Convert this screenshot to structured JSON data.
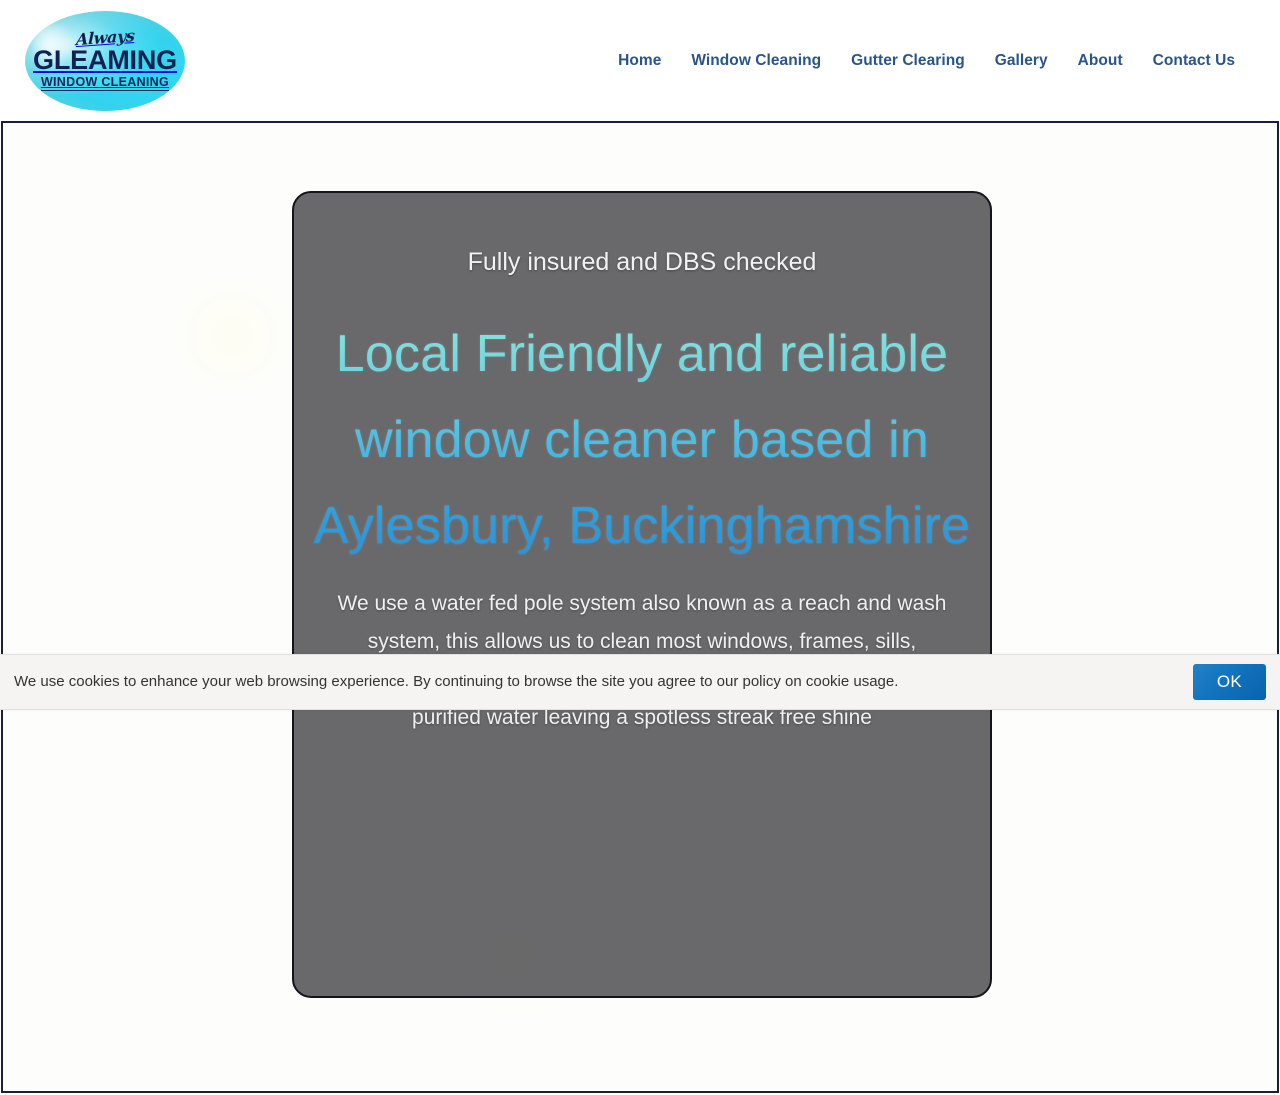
{
  "header": {
    "logo": {
      "script_word": "Always",
      "main_word": "GLEAMING",
      "sub_word": "WINDOW CLEANING"
    },
    "nav": [
      {
        "label": "Home"
      },
      {
        "label": "Window Cleaning"
      },
      {
        "label": "Gutter Clearing"
      },
      {
        "label": "Gallery"
      },
      {
        "label": "About"
      },
      {
        "label": "Contact Us"
      }
    ]
  },
  "hero": {
    "eyebrow": "Fully insured and DBS checked",
    "title": "Local Friendly and reliable window cleaner based in Aylesbury, Buckinghamshire",
    "body": "We use a water fed pole system also known as a reach and wash system, this allows us to clean most windows, frames, sills, fascia's and gutters from the safety of the ground using ultra purified water leaving a spotless streak free shine"
  },
  "cookie_banner": {
    "message": "We use cookies to enhance your web browsing experience. By continuing to browse the site you agree to our policy on cookie usage.",
    "accept_label": "OK"
  },
  "colors": {
    "nav_link": "#2a5588",
    "logo_oval": "#33d3ee",
    "logo_text": "#132152",
    "hero_card_bg": "#545456",
    "hero_title_top": "#8fe9e0",
    "hero_title_bottom": "#2b8fd6",
    "cookie_bg": "#f5f4f2",
    "ok_button": "#1374bf",
    "frame_border": "#1a1f35"
  }
}
